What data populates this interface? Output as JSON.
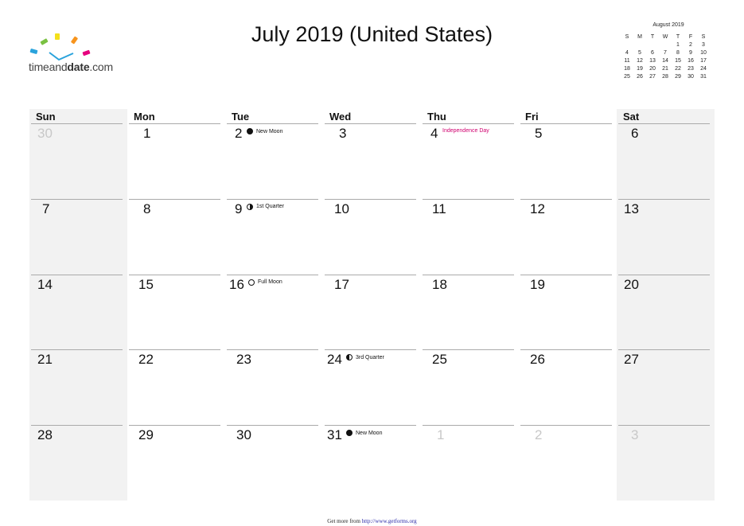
{
  "logo": {
    "text_light": "timeand",
    "text_bold": "date",
    "text_suffix": ".com",
    "bar_colors": [
      "#2aa3dc",
      "#7ac142",
      "#f4e01b",
      "#f7941d",
      "#e6007e"
    ],
    "check_color": "#2aa3dc"
  },
  "title": "July 2019 (United States)",
  "mini_calendar": {
    "title": "August 2019",
    "weekdays": [
      "S",
      "M",
      "T",
      "W",
      "T",
      "F",
      "S"
    ],
    "weeks": [
      [
        "",
        "",
        "",
        "",
        "1",
        "2",
        "3"
      ],
      [
        "4",
        "5",
        "6",
        "7",
        "8",
        "9",
        "10"
      ],
      [
        "11",
        "12",
        "13",
        "14",
        "15",
        "16",
        "17"
      ],
      [
        "18",
        "19",
        "20",
        "21",
        "22",
        "23",
        "24"
      ],
      [
        "25",
        "26",
        "27",
        "28",
        "29",
        "30",
        "31"
      ]
    ]
  },
  "calendar": {
    "weekdays": [
      "Sun",
      "Mon",
      "Tue",
      "Wed",
      "Thu",
      "Fri",
      "Sat"
    ],
    "weekend_bg": "#f2f2f2",
    "holiday_color": "#d0006f",
    "weeks": [
      [
        {
          "day": "30",
          "other": true
        },
        {
          "day": "1"
        },
        {
          "day": "2",
          "event": "New Moon",
          "moon": "new"
        },
        {
          "day": "3"
        },
        {
          "day": "4",
          "event": "Independence Day",
          "holiday": true
        },
        {
          "day": "5"
        },
        {
          "day": "6"
        }
      ],
      [
        {
          "day": "7"
        },
        {
          "day": "8"
        },
        {
          "day": "9",
          "event": "1st Quarter",
          "moon": "first"
        },
        {
          "day": "10"
        },
        {
          "day": "11"
        },
        {
          "day": "12"
        },
        {
          "day": "13"
        }
      ],
      [
        {
          "day": "14"
        },
        {
          "day": "15"
        },
        {
          "day": "16",
          "event": "Full Moon",
          "moon": "full"
        },
        {
          "day": "17"
        },
        {
          "day": "18"
        },
        {
          "day": "19"
        },
        {
          "day": "20"
        }
      ],
      [
        {
          "day": "21"
        },
        {
          "day": "22"
        },
        {
          "day": "23"
        },
        {
          "day": "24",
          "event": "3rd Quarter",
          "moon": "third"
        },
        {
          "day": "25"
        },
        {
          "day": "26"
        },
        {
          "day": "27"
        }
      ],
      [
        {
          "day": "28"
        },
        {
          "day": "29"
        },
        {
          "day": "30"
        },
        {
          "day": "31",
          "event": "New Moon",
          "moon": "new"
        },
        {
          "day": "1",
          "other": true
        },
        {
          "day": "2",
          "other": true
        },
        {
          "day": "3",
          "other": true
        }
      ]
    ]
  },
  "footer": {
    "prefix": "Get more from ",
    "link": "http://www.getforms.org"
  }
}
